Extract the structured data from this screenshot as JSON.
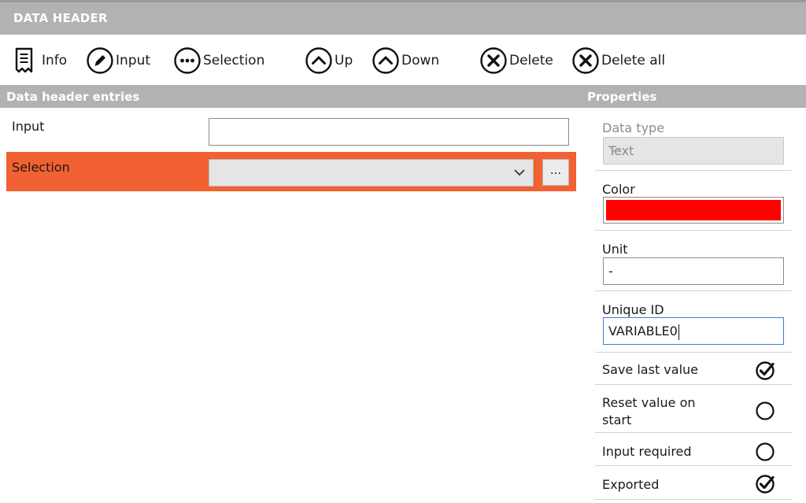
{
  "header": {
    "title": "DATA HEADER"
  },
  "toolbar": {
    "info": "Info",
    "input": "Input",
    "selection": "Selection",
    "up": "Up",
    "down": "Down",
    "delete": "Delete",
    "delete_all": "Delete all"
  },
  "entries_panel": {
    "title": "Data header entries",
    "entries": [
      {
        "label": "Input",
        "type": "text",
        "value": ""
      },
      {
        "label": "Selection",
        "type": "select",
        "value": "",
        "more_label": "..."
      }
    ]
  },
  "properties": {
    "title": "Properties",
    "data_type": {
      "label": "Data type",
      "value": "Text"
    },
    "color": {
      "label": "Color",
      "value": "#ff0000"
    },
    "unit": {
      "label": "Unit",
      "value": "-"
    },
    "unique_id": {
      "label": "Unique ID",
      "value": "VARIABLE0"
    },
    "save_last_value": {
      "label": "Save last value",
      "checked": true
    },
    "reset_value_on_start": {
      "label_line1": "Reset value on",
      "label_line2": "start",
      "checked": false
    },
    "input_required": {
      "label": "Input required",
      "checked": false
    },
    "exported": {
      "label": "Exported",
      "checked": true
    }
  },
  "colors": {
    "header_bg": "#b2b2b2",
    "selected_row": "#f26131",
    "swatch": "#ff0000",
    "focus_border": "#3b7fd4"
  }
}
